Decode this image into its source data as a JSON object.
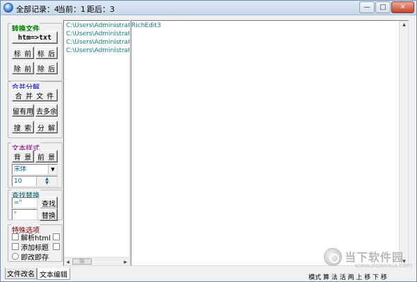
{
  "titlebar": {
    "total_records": "全部记录：4",
    "current": "当前：1",
    "after": "距后：3",
    "min_glyph": "—",
    "max_glyph": "□",
    "close_glyph": "✕"
  },
  "convert": {
    "title": "转换文件",
    "htm_to_txt": "htm=>txt",
    "mark_front": "标 前",
    "mark_back": "标 后",
    "del_front": "除 前",
    "del_back": "除 后"
  },
  "merge": {
    "title": "合并分解",
    "merge_files": "合 并 文 件",
    "keep_useful": "留有用",
    "remove_extra": "去多余",
    "search": "搜 索",
    "split": "分 解"
  },
  "style": {
    "title": "文本样式",
    "background": "背 景",
    "foreground": "前 景",
    "font_value": "宋体",
    "size_value": "10"
  },
  "find": {
    "title": "查找替换",
    "find_value": "=\"",
    "replace_value": "\"",
    "find_button": "查找",
    "replace_button": "替换"
  },
  "special": {
    "title": "特殊选项",
    "parse_html": "解析html",
    "add_title": "添加标题",
    "save_on_change": "即改即存"
  },
  "list": {
    "items": [
      "C:\\Users\\Administrator",
      "C:\\Users\\Administrator",
      "C:\\Users\\Administrator",
      "C:\\Users\\Administrator"
    ],
    "scroll_thumb": "|||"
  },
  "editor": {
    "text": "RichEdit3"
  },
  "tabs": [
    {
      "label": "文件改名"
    },
    {
      "label": "文本编辑"
    }
  ],
  "statusbar": {
    "text": "模式  算 法 活  两 上  移 下  移"
  },
  "watermark": {
    "name": "当下软件园",
    "url": "www.downxia.com"
  },
  "colors": {
    "group_convert": "#008000",
    "group_merge": "#0000c0",
    "group_style": "#800080",
    "group_find": "#006060",
    "group_special": "#800000",
    "list_text": "#108080"
  }
}
